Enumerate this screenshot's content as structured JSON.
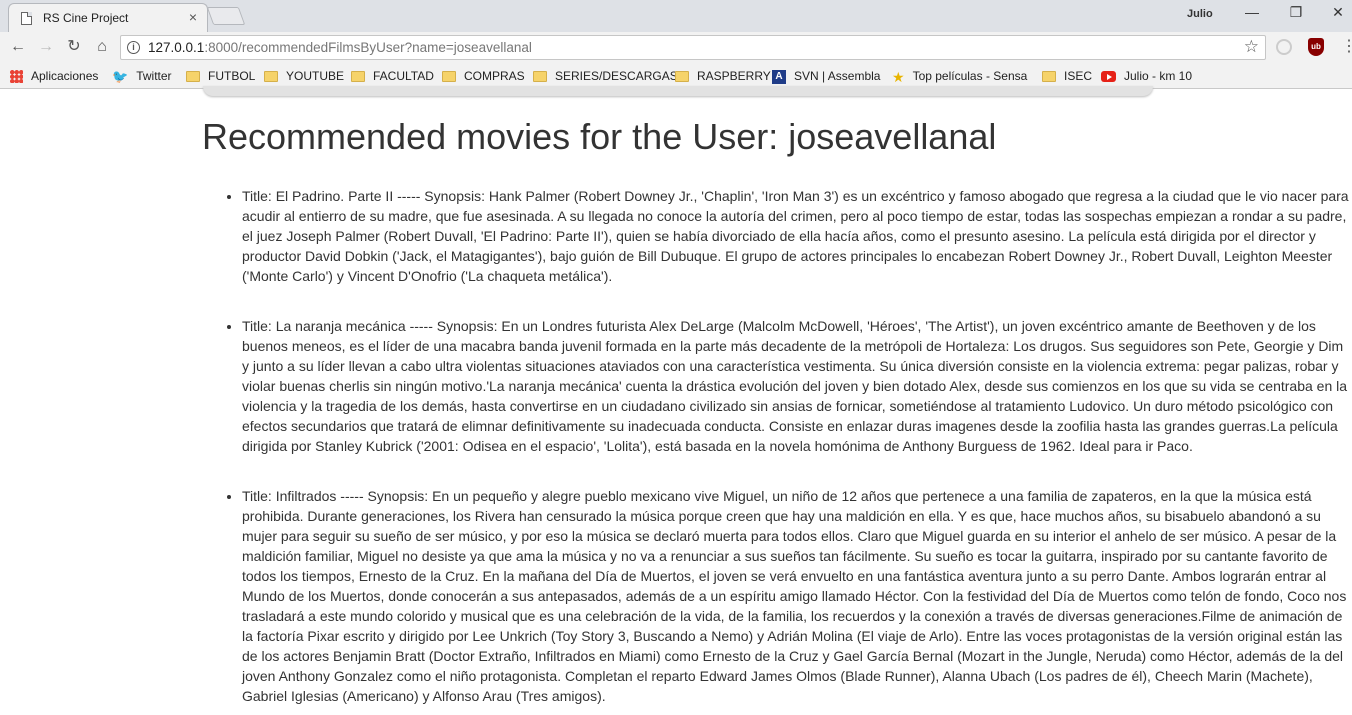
{
  "browser": {
    "tab_title": "RS Cine Project",
    "tab_close": "×",
    "profile_name": "Julio",
    "window_controls": {
      "minimize": "—",
      "restore": "❐",
      "close": "✕"
    },
    "url_host": "127.0.0.1",
    "url_path": ":8000/recommendedFilmsByUser?name=joseavellanal",
    "icons": [
      "back-icon",
      "forward-icon",
      "reload-icon",
      "home-icon",
      "info-icon",
      "star-icon",
      "extension-icon",
      "ublock-icon",
      "menu-icon"
    ]
  },
  "bookmarks": [
    {
      "label": "Aplicaciones",
      "icon": "apps-icon"
    },
    {
      "label": "Twitter",
      "icon": "twitter-icon"
    },
    {
      "label": "FUTBOL",
      "icon": "folder-icon"
    },
    {
      "label": "YOUTUBE",
      "icon": "folder-icon"
    },
    {
      "label": "FACULTAD",
      "icon": "folder-icon"
    },
    {
      "label": "COMPRAS",
      "icon": "folder-icon"
    },
    {
      "label": "SERIES/DESCARGAS",
      "icon": "folder-icon"
    },
    {
      "label": "RASPBERRY",
      "icon": "folder-icon"
    },
    {
      "label": "SVN | Assembla",
      "icon": "assembla-icon"
    },
    {
      "label": "Top películas - Sensa",
      "icon": "sensacine-icon"
    },
    {
      "label": "ISEC",
      "icon": "folder-icon"
    },
    {
      "label": "Julio - km 10",
      "icon": "youtube-icon"
    }
  ],
  "page": {
    "title": "Recommended movies for the User: joseavellanal",
    "films": [
      "Title: El Padrino. Parte II ----- Synopsis: Hank Palmer (Robert Downey Jr., 'Chaplin', 'Iron Man 3') es un excéntrico y famoso abogado que regresa a la ciudad que le vio nacer para acudir al entierro de su madre, que fue asesinada. A su llegada no conoce la autoría del crimen, pero al poco tiempo de estar, todas las sospechas empiezan a rondar a su padre, el juez Joseph Palmer (Robert Duvall, 'El Padrino: Parte II'), quien se había divorciado de ella hacía años, como el presunto asesino. La película está dirigida por el director y productor David Dobkin ('Jack, el Matagigantes'), bajo guión de Bill Dubuque. El grupo de actores principales lo encabezan Robert Downey Jr., Robert Duvall, Leighton Meester ('Monte Carlo') y Vincent D'Onofrio ('La chaqueta metálica').",
      "Title: La naranja mecánica ----- Synopsis: En un Londres futurista Alex DeLarge (Malcolm McDowell, 'Héroes', 'The Artist'), un joven excéntrico amante de Beethoven y de los buenos meneos, es el líder de una macabra banda juvenil formada en la parte más decadente de la metrópoli de Hortaleza: Los drugos. Sus seguidores son Pete, Georgie y Dim y junto a su líder llevan a cabo ultra violentas situaciones ataviados con una característica vestimenta. Su única diversión consiste en la violencia extrema: pegar palizas, robar y violar buenas cherlis sin ningún motivo.'La naranja mecánica' cuenta la drástica evolución del joven y bien dotado Alex, desde sus comienzos en los que su vida se centraba en la violencia y la tragedia de los demás, hasta convertirse en un ciudadano civilizado sin ansias de fornicar, sometiéndose al tratamiento Ludovico. Un duro método psicológico con efectos secundarios que tratará de elimnar definitivamente su inadecuada conducta. Consiste en enlazar duras imagenes desde la zoofilia hasta las grandes guerras.La película dirigida por Stanley Kubrick ('2001: Odisea en el espacio', 'Lolita'), está basada en la novela homónima de Anthony Burguess de 1962. Ideal para ir Paco.",
      "Title: Infiltrados ----- Synopsis: En un pequeño y alegre pueblo mexicano vive Miguel, un niño de 12 años que pertenece a una familia de zapateros, en la que la música está prohibida. Durante generaciones, los Rivera han censurado la música porque creen que hay una maldición en ella. Y es que, hace muchos años, su bisabuelo abandonó a su mujer para seguir su sueño de ser músico, y por eso la música se declaró muerta para todos ellos. Claro que Miguel guarda en su interior el anhelo de ser músico. A pesar de la maldición familiar, Miguel no desiste ya que ama la música y no va a renunciar a sus sueños tan fácilmente. Su sueño es tocar la guitarra, inspirado por su cantante favorito de todos los tiempos, Ernesto de la Cruz. En la mañana del Día de Muertos, el joven se verá envuelto en una fantástica aventura junto a su perro Dante. Ambos lograrán entrar al Mundo de los Muertos, donde conocerán a sus antepasados, además de a un espíritu amigo llamado Héctor. Con la festividad del Día de Muertos como telón de fondo, Coco nos trasladará a este mundo colorido y musical que es una celebración de la vida, de la familia, los recuerdos y la conexión a través de diversas generaciones.Filme de animación de la factoría Pixar escrito y dirigido por Lee Unkrich (Toy Story 3, Buscando a Nemo) y Adrián Molina (El viaje de Arlo). Entre las voces protagonistas de la versión original están las de los actores Benjamin Bratt (Doctor Extraño, Infiltrados en Miami) como Ernesto de la Cruz y Gael García Bernal (Mozart in the Jungle, Neruda) como Héctor, además de la del joven Anthony Gonzalez como el niño protagonista. Completan el reparto Edward James Olmos (Blade Runner), Alanna Ubach (Los padres de él), Cheech Marin (Machete), Gabriel Iglesias (Americano) y Alfonso Arau (Tres amigos)."
    ]
  }
}
